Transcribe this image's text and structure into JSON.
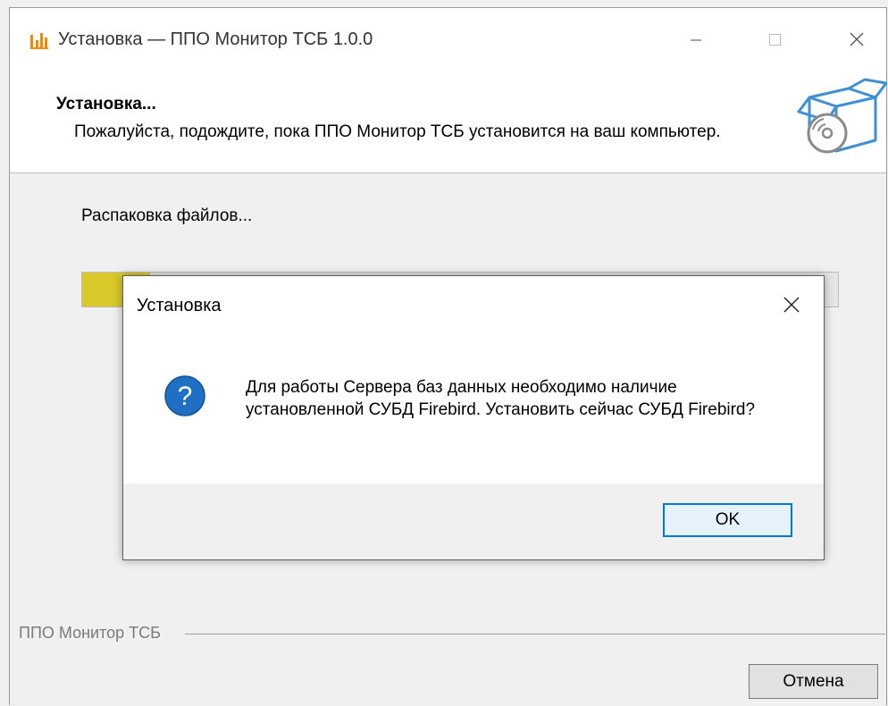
{
  "window": {
    "title": "Установка — ППО Монитор ТСБ 1.0.0",
    "app_icon": "bar-chart-icon",
    "brand_color": "#f08a00"
  },
  "header": {
    "title": "Установка...",
    "description": "Пожалуйста, подождите, пока ППО Монитор ТСБ установится на ваш компьютер.",
    "graphic": "box-with-disc-icon"
  },
  "main": {
    "status_text": "Распаковка файлов...",
    "progress_fraction": 0.09,
    "progress_color": "#d9c92c"
  },
  "footer": {
    "group_label": "ППО Монитор ТСБ",
    "cancel_label": "Отмена"
  },
  "dialog": {
    "title": "Установка",
    "icon": "question-icon",
    "message": "Для работы Сервера баз данных необходимо наличие установленной СУБД Firebird. Установить сейчас СУБД Firebird?",
    "ok_label": "OK",
    "accent_color": "#0078d7"
  }
}
